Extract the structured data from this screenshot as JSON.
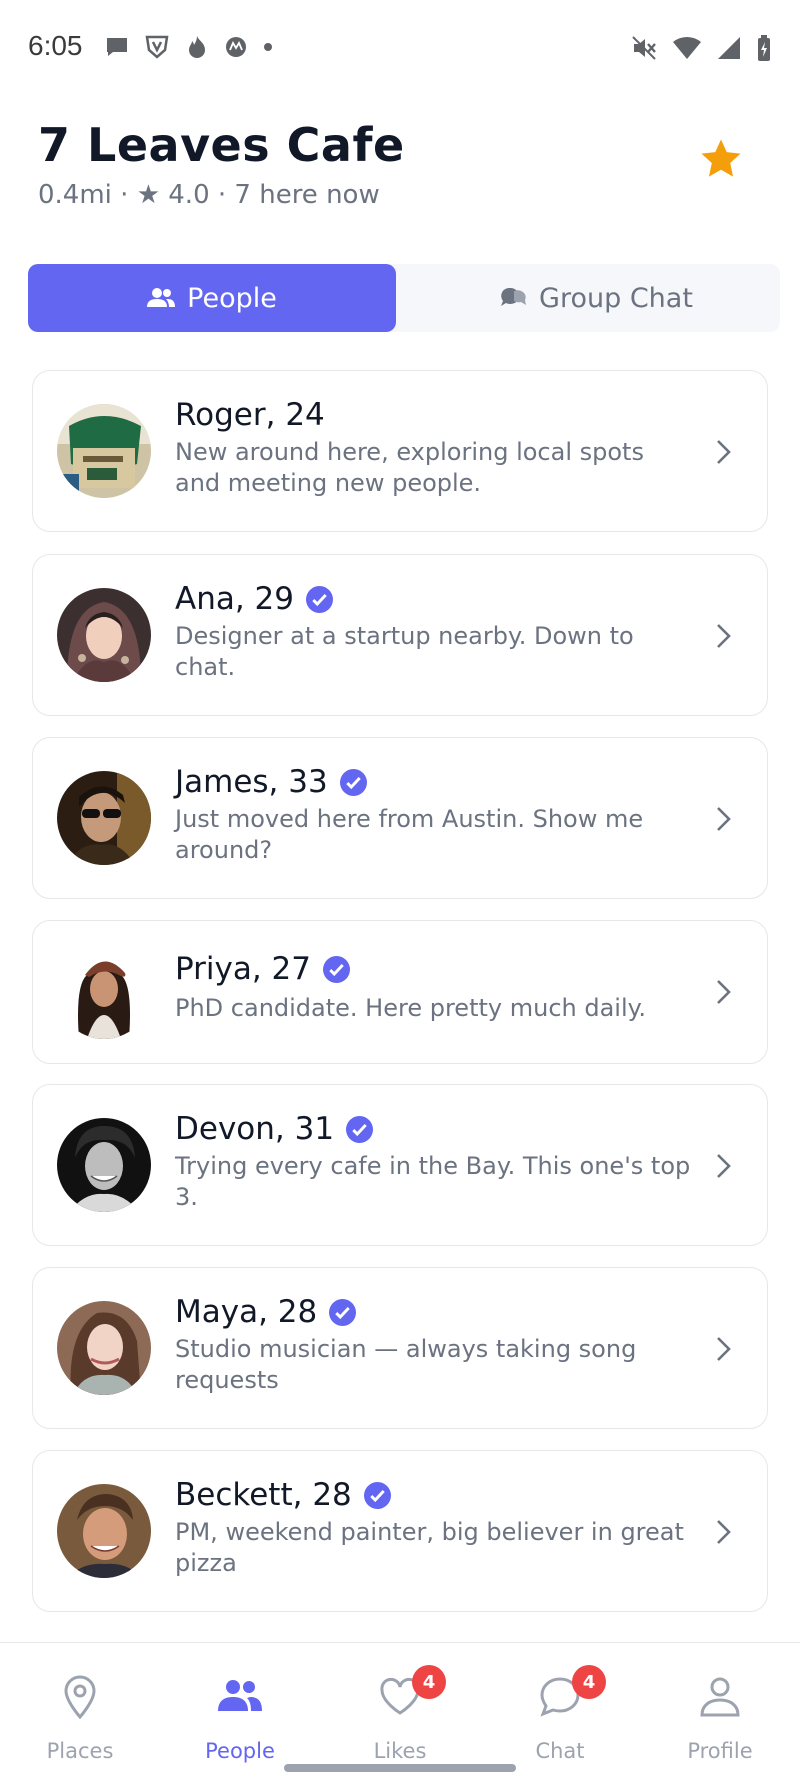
{
  "status_bar": {
    "time": "6:05"
  },
  "venue": {
    "name": "7 Leaves Cafe",
    "meta": "0.4mi · ★ 4.0 · 7 here now"
  },
  "tabs": {
    "people": "People",
    "group_chat": "Group Chat",
    "active": "People"
  },
  "people": [
    {
      "name": "Roger, 24",
      "verified": false,
      "bio": "New around here, exploring local spots and meeting new people."
    },
    {
      "name": "Ana, 29",
      "verified": true,
      "bio": "Designer at a startup nearby. Down to chat."
    },
    {
      "name": "James, 33",
      "verified": true,
      "bio": "Just moved here from Austin. Show me around?"
    },
    {
      "name": "Priya, 27",
      "verified": true,
      "bio": "PhD candidate. Here pretty much daily."
    },
    {
      "name": "Devon, 31",
      "verified": true,
      "bio": "Trying every cafe in the Bay. This one's top 3."
    },
    {
      "name": "Maya, 28",
      "verified": true,
      "bio": "Studio musician — always taking song requests"
    },
    {
      "name": "Beckett, 28",
      "verified": true,
      "bio": "PM, weekend painter, big believer in great pizza"
    }
  ],
  "bottom_nav": {
    "items": [
      {
        "label": "Places",
        "icon": "map-pin-icon"
      },
      {
        "label": "People",
        "icon": "people-icon"
      },
      {
        "label": "Likes",
        "icon": "heart-icon",
        "badge": "4"
      },
      {
        "label": "Chat",
        "icon": "chat-bubble-icon",
        "badge": "4"
      },
      {
        "label": "Profile",
        "icon": "profile-icon"
      }
    ],
    "active": "People"
  },
  "colors": {
    "accent": "#6366f1",
    "star": "#f59e0b",
    "badge": "#ef4444"
  }
}
